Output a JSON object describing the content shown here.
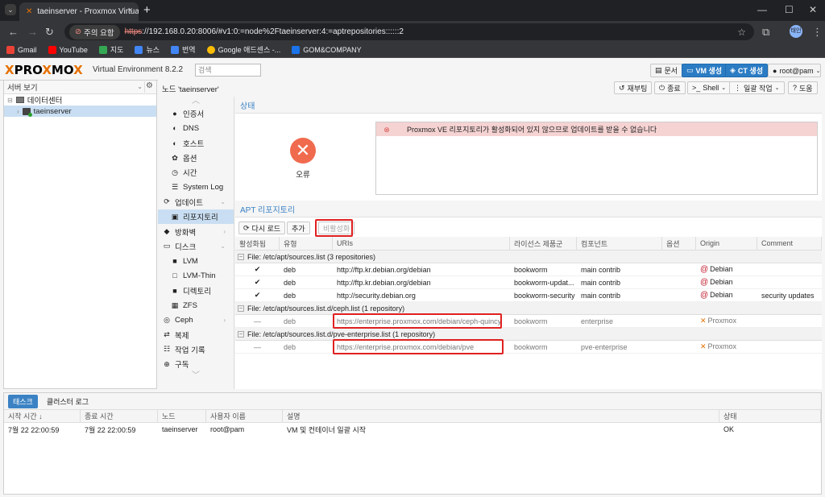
{
  "browser": {
    "tab_title": "taeinserver - Proxmox Virtual E",
    "security_label": "주의 요함",
    "url_scheme": "https",
    "url_rest": "://192.168.0.20:8006/#v1:0:=node%2Ftaeinserver:4:=aptrepositories::::::2",
    "profile_label": "태인",
    "bookmarks": [
      "Gmail",
      "YouTube",
      "지도",
      "뉴스",
      "번역",
      "Google 애드센스 -...",
      "GOM&COMPANY"
    ]
  },
  "pve": {
    "logo_text_a": "PRO",
    "logo_text_x": "X",
    "logo_text_b": "MO",
    "logo_text_c": "X",
    "version": "Virtual Environment 8.2.2",
    "search_placeholder": "검색",
    "docs_label": "문서",
    "create_vm_label": "VM 생성",
    "create_ct_label": "CT 생성",
    "user_label": "root@pam"
  },
  "tree": {
    "view_label": "서버 보기",
    "datacenter": "데이터센터",
    "node": "taeinserver"
  },
  "nodebar": {
    "title": "노드 'taeinserver'",
    "reboot": "재부팅",
    "shutdown": "종료",
    "shell": "Shell",
    "bulk": "일괄 작업",
    "help": "도움"
  },
  "menu": {
    "items": [
      {
        "icon": "●",
        "label": "인증서"
      },
      {
        "icon": "◐",
        "label": "DNS"
      },
      {
        "icon": "◐",
        "label": "호스트"
      },
      {
        "icon": "✿",
        "label": "옵션"
      },
      {
        "icon": "◷",
        "label": "시간"
      },
      {
        "icon": "☰",
        "label": "System Log"
      },
      {
        "icon": "⟳",
        "label": "업데이트"
      },
      {
        "icon": "▣",
        "label": "리포지토리"
      },
      {
        "icon": "◆",
        "label": "방화벽"
      },
      {
        "icon": "▭",
        "label": "디스크"
      },
      {
        "icon": "■",
        "label": "LVM"
      },
      {
        "icon": "□",
        "label": "LVM-Thin"
      },
      {
        "icon": "■",
        "label": "디렉토리"
      },
      {
        "icon": "▦",
        "label": "ZFS"
      },
      {
        "icon": "◎",
        "label": "Ceph"
      },
      {
        "icon": "⇄",
        "label": "복제"
      },
      {
        "icon": "☷",
        "label": "작업 기록"
      },
      {
        "icon": "⊕",
        "label": "구독"
      }
    ]
  },
  "status": {
    "header": "상태",
    "error_label": "오류",
    "message": "Proxmox VE 리포지토리가 활성화되어 있지 않으므로 업데이트를 받을 수 없습니다"
  },
  "apt": {
    "header": "APT 리포지토리",
    "reload": "다시 로드",
    "add": "추가",
    "disable": "비활성화",
    "columns": [
      "활성화됨",
      "유형",
      "URIs",
      "라이선스 제품군",
      "컴포넌트",
      "옵션",
      "Origin",
      "Comment"
    ],
    "groups": [
      {
        "title": "File: /etc/apt/sources.list (3 repositories)",
        "rows": [
          {
            "enabled": "✔",
            "type": "deb",
            "uri": "http://ftp.kr.debian.org/debian",
            "suite": "bookworm",
            "components": "main contrib",
            "options": "",
            "origin": "Debian",
            "comment": ""
          },
          {
            "enabled": "✔",
            "type": "deb",
            "uri": "http://ftp.kr.debian.org/debian",
            "suite": "bookworm-updat...",
            "components": "main contrib",
            "options": "",
            "origin": "Debian",
            "comment": ""
          },
          {
            "enabled": "✔",
            "type": "deb",
            "uri": "http://security.debian.org",
            "suite": "bookworm-security",
            "components": "main contrib",
            "options": "",
            "origin": "Debian",
            "comment": "security updates"
          }
        ]
      },
      {
        "title": "File: /etc/apt/sources.list.d/ceph.list (1 repository)",
        "rows": [
          {
            "enabled": "—",
            "type": "deb",
            "uri": "https://enterprise.proxmox.com/debian/ceph-quincy",
            "suite": "bookworm",
            "components": "enterprise",
            "options": "",
            "origin": "Proxmox",
            "comment": ""
          }
        ]
      },
      {
        "title": "File: /etc/apt/sources.list.d/pve-enterprise.list (1 repository)",
        "rows": [
          {
            "enabled": "—",
            "type": "deb",
            "uri": "https://enterprise.proxmox.com/debian/pve",
            "suite": "bookworm",
            "components": "pve-enterprise",
            "options": "",
            "origin": "Proxmox",
            "comment": ""
          }
        ]
      }
    ]
  },
  "tasks": {
    "tab_tasks": "태스크",
    "tab_cluster_log": "클러스터 로그",
    "columns": [
      "시작 시간 ↓",
      "종료 시간",
      "노드",
      "사용자 이름",
      "설명",
      "상태"
    ],
    "rows": [
      {
        "start": "7월 22 22:00:59",
        "end": "7월 22 22:00:59",
        "node": "taeinserver",
        "user": "root@pam",
        "desc": "VM 및 컨테이너 일괄 시작",
        "status": "OK"
      }
    ]
  },
  "colors": {
    "accent": "#3b82c4",
    "error": "#f06a4e",
    "highlight": "#e02020",
    "proxmox_orange": "#e57000"
  }
}
